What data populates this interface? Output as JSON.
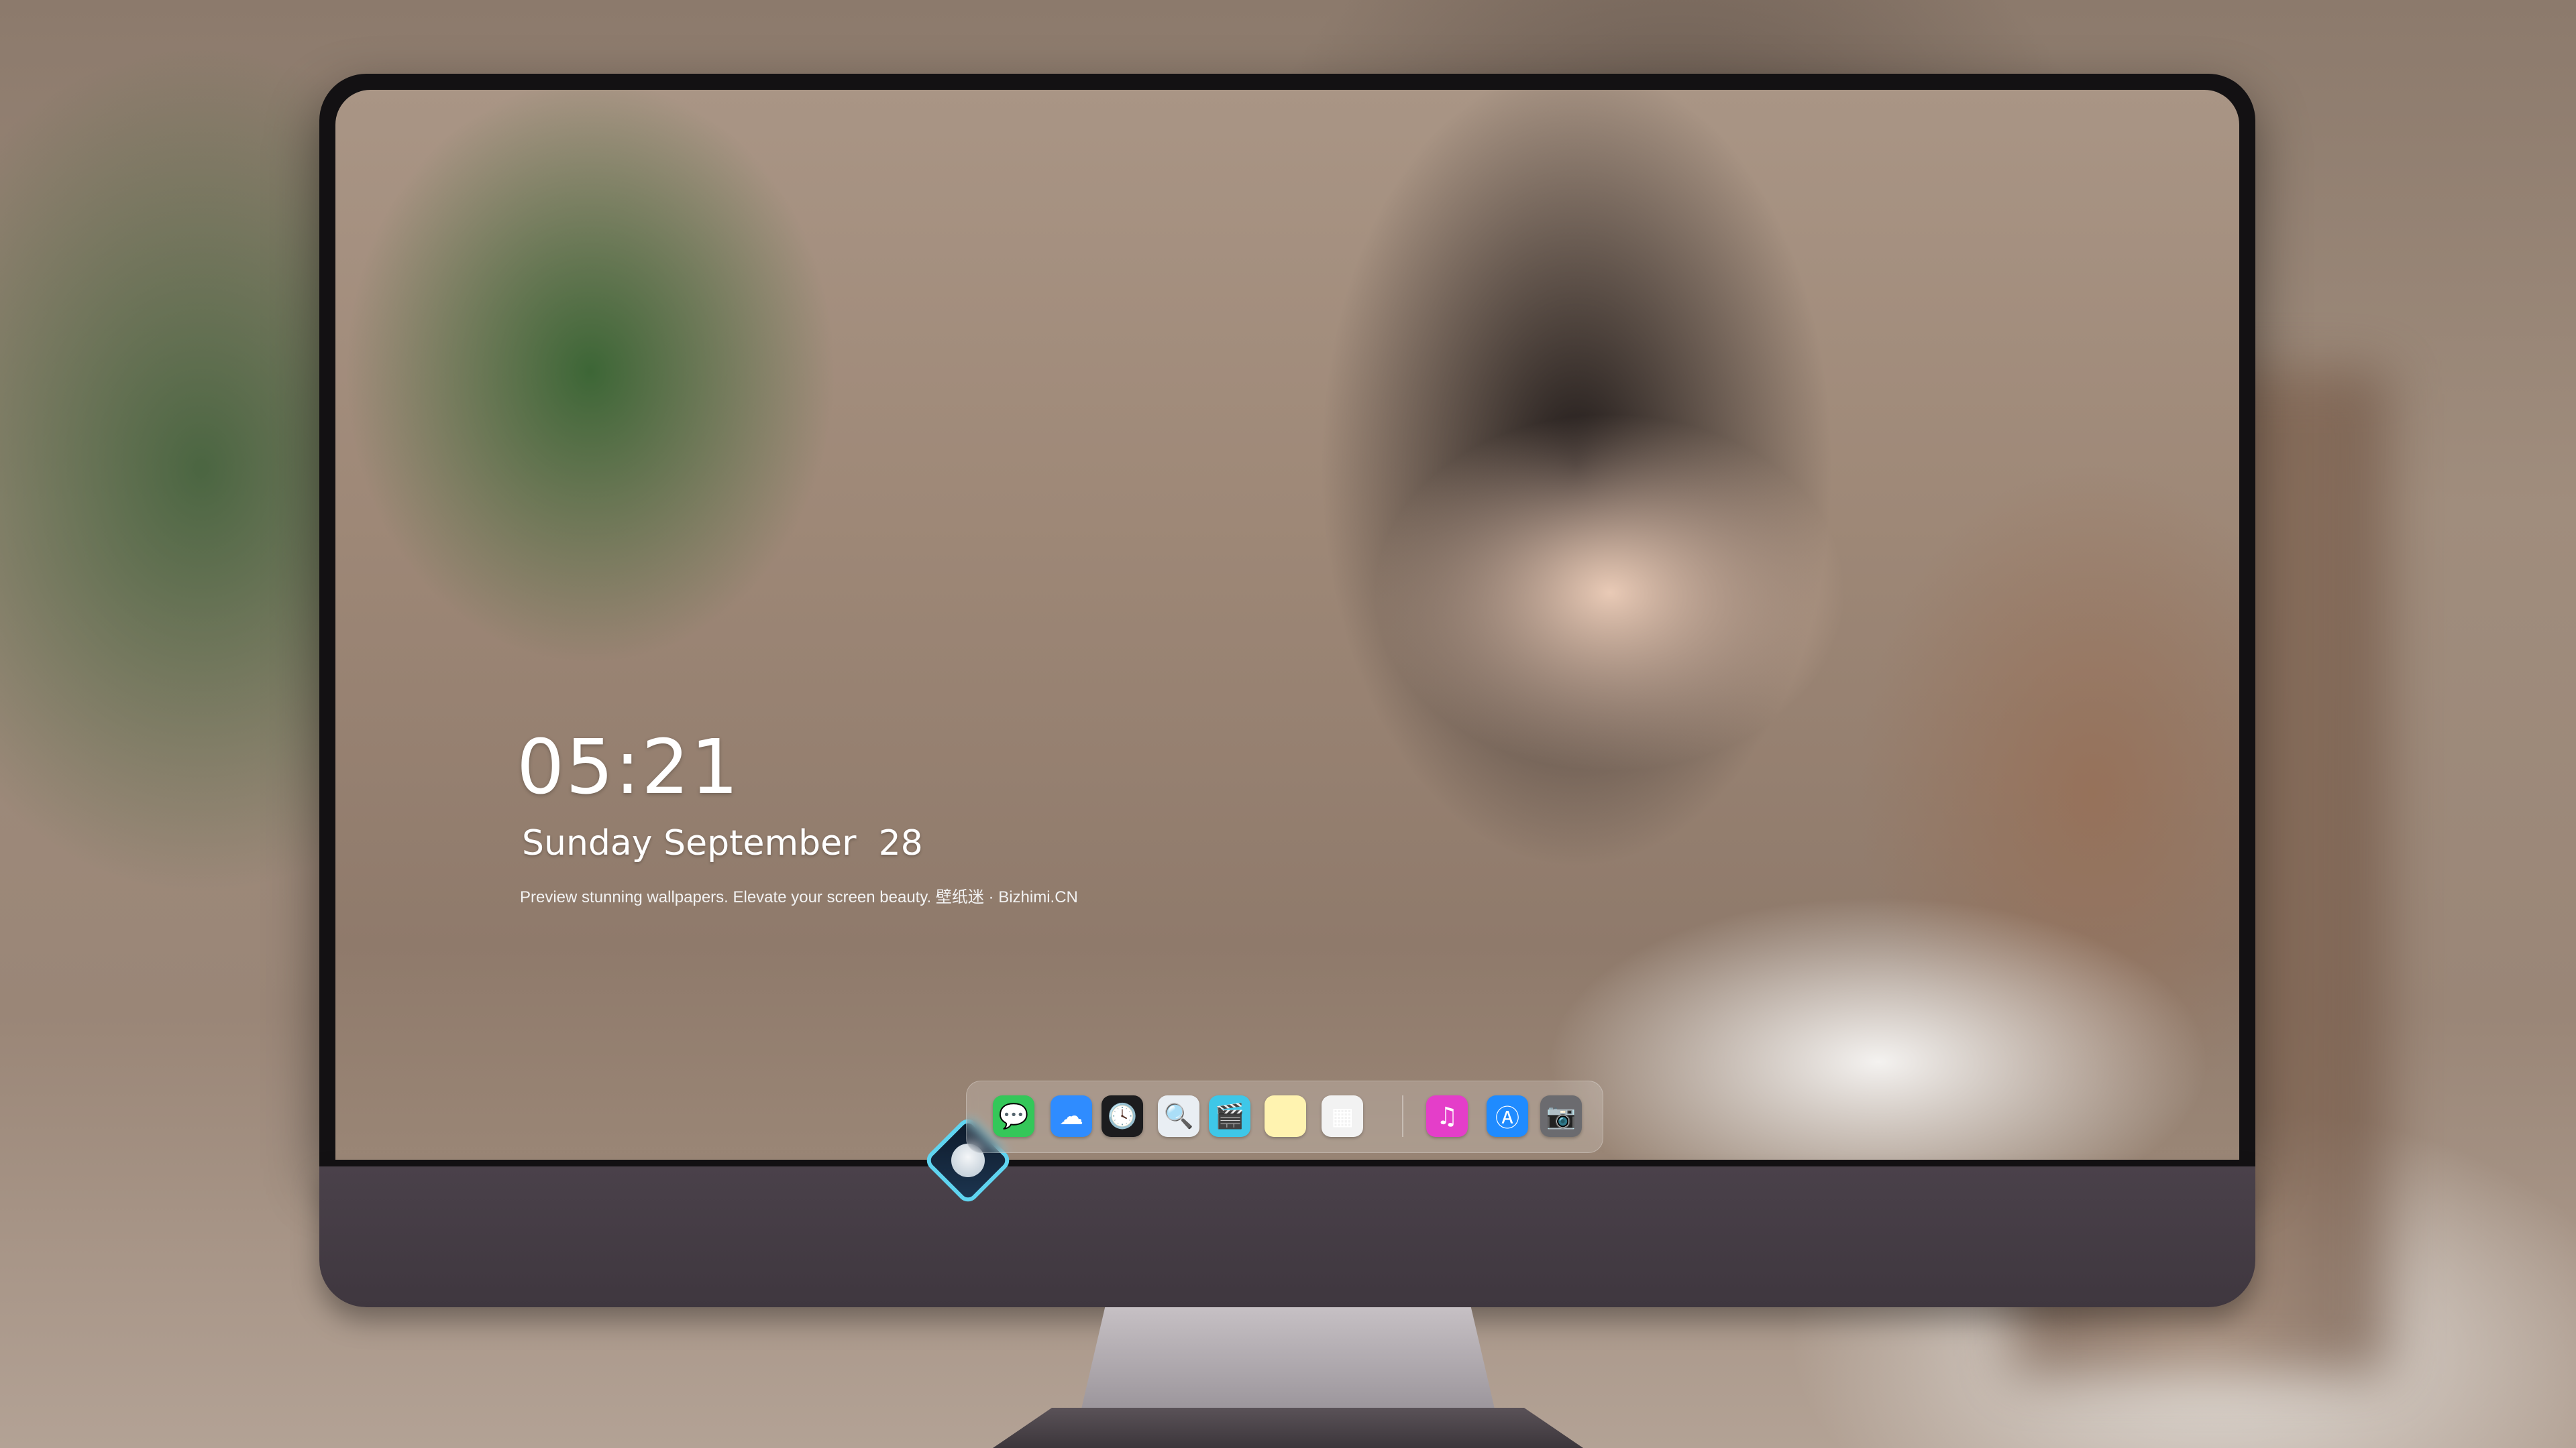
{
  "lock_screen": {
    "time": "05:21",
    "date": "Sunday September  28",
    "tagline": "Preview stunning wallpapers. Elevate your screen beauty. 壁纸迷 · Bizhimi.CN"
  },
  "dock": {
    "items": [
      {
        "name": "messages-icon",
        "glyph": "💬",
        "color": "#34c759"
      },
      {
        "name": "weather-icon",
        "glyph": "☁",
        "color": "#2f8cff"
      },
      {
        "name": "clock-icon",
        "glyph": "🕓",
        "color": "#1c1c1e"
      },
      {
        "name": "preview-icon",
        "glyph": "🔍",
        "color": "#e9eef3"
      },
      {
        "name": "videos-icon",
        "glyph": "🎬",
        "color": "#3ec7e8"
      },
      {
        "name": "notes-icon",
        "glyph": "",
        "color": "#fff3b0"
      },
      {
        "name": "photos-icon",
        "glyph": "▦",
        "color": "#f2f2f2"
      },
      {
        "name": "music-icon",
        "glyph": "♫",
        "color": "#e43ec9"
      },
      {
        "name": "app-store-icon",
        "glyph": "Ⓐ",
        "color": "#1f8bff"
      },
      {
        "name": "camera-icon",
        "glyph": "📷",
        "color": "#6b6b6f"
      }
    ]
  },
  "colors": {
    "bezel": "#131113",
    "chin": "#4a414a",
    "logo_accent": "#5fd4f0"
  }
}
